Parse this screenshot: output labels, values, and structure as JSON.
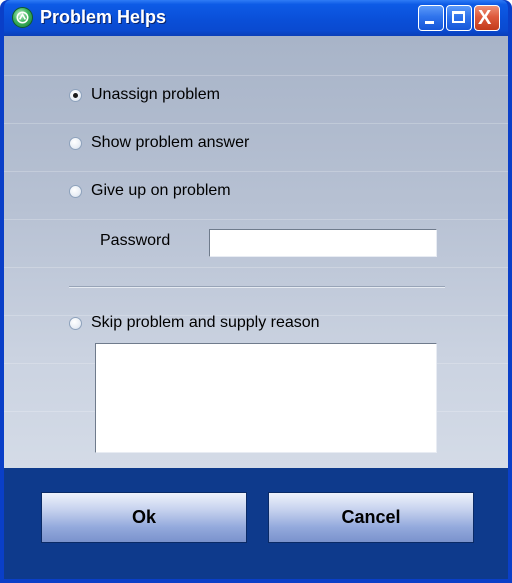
{
  "window": {
    "title": "Problem Helps",
    "controls": {
      "minimize_icon": "minimize-icon",
      "maximize_icon": "maximize-icon",
      "close_icon": "close-icon",
      "close_glyph": "X"
    }
  },
  "options": {
    "unassign": {
      "label": "Unassign problem",
      "checked": true
    },
    "show_answer": {
      "label": "Show problem answer",
      "checked": false
    },
    "give_up": {
      "label": "Give up on problem",
      "checked": false
    },
    "skip": {
      "label": "Skip problem and supply reason",
      "checked": false
    }
  },
  "password": {
    "label": "Password",
    "value": ""
  },
  "reason": {
    "value": ""
  },
  "buttons": {
    "ok": "Ok",
    "cancel": "Cancel"
  },
  "colors": {
    "titlebar": "#0a4fd8",
    "frame": "#0a3fc8",
    "footer": "#0e3a8c",
    "close_button": "#de5a3c"
  }
}
